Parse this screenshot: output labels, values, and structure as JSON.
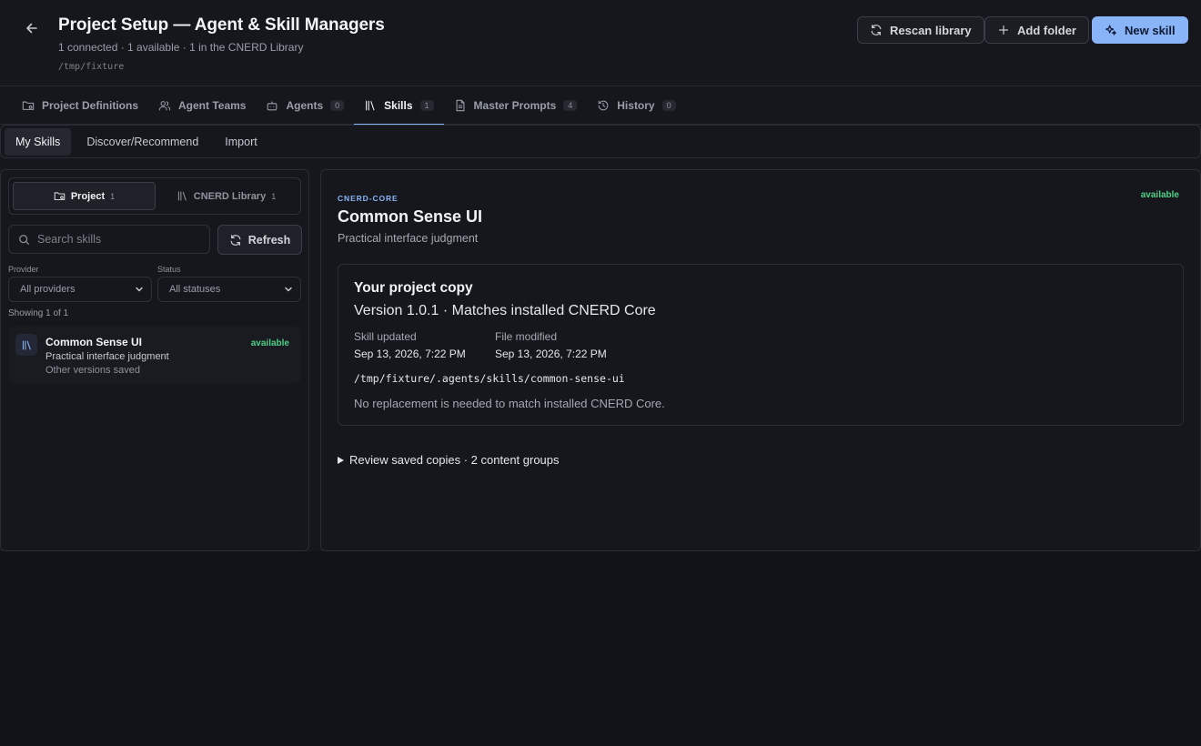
{
  "header": {
    "title": "Project Setup — Agent & Skill Managers",
    "subtitle": "1 connected · 1 available · 1 in the CNERD Library",
    "path": "/tmp/fixture",
    "buttons": {
      "rescan": "Rescan library",
      "add_folder": "Add folder",
      "new_skill": "New skill"
    }
  },
  "tabs": [
    {
      "label": "Project Definitions",
      "icon": "folder-settings-icon"
    },
    {
      "label": "Agent Teams",
      "icon": "users-icon"
    },
    {
      "label": "Agents",
      "count": "0",
      "icon": "bot-icon"
    },
    {
      "label": "Skills",
      "count": "1",
      "icon": "library-icon",
      "active": true
    },
    {
      "label": "Master Prompts",
      "count": "4",
      "icon": "document-icon"
    },
    {
      "label": "History",
      "count": "0",
      "icon": "history-icon"
    }
  ],
  "subtabs": [
    "My Skills",
    "Discover/Recommend",
    "Import"
  ],
  "left": {
    "segments": [
      {
        "label": "Project",
        "count": "1"
      },
      {
        "label": "CNERD Library",
        "count": "1"
      }
    ],
    "search_placeholder": "Search skills",
    "refresh": "Refresh",
    "provider_label": "Provider",
    "provider_value": "All providers",
    "status_label": "Status",
    "status_value": "All statuses",
    "showing": "Showing 1 of 1",
    "items": [
      {
        "title": "Common Sense UI",
        "description": "Practical interface judgment",
        "note": "Other versions saved",
        "status": "available"
      }
    ]
  },
  "detail": {
    "provider": "CNERD-CORE",
    "status": "available",
    "title": "Common Sense UI",
    "description": "Practical interface judgment",
    "card": {
      "title": "Your project copy",
      "version": "Version 1.0.1 · Matches installed CNERD Core",
      "skill_updated_label": "Skill updated",
      "skill_updated": "Sep 13, 2026, 7:22 PM",
      "file_modified_label": "File modified",
      "file_modified": "Sep 13, 2026, 7:22 PM",
      "path": "/tmp/fixture/.agents/skills/common-sense-ui",
      "note": "No replacement is needed to match installed CNERD Core."
    },
    "review": "Review saved copies · 2 content groups"
  },
  "colors": {
    "accent": "#8ab4f8",
    "available": "#4fcf86",
    "background": "#111217",
    "panel": "#15171d"
  }
}
